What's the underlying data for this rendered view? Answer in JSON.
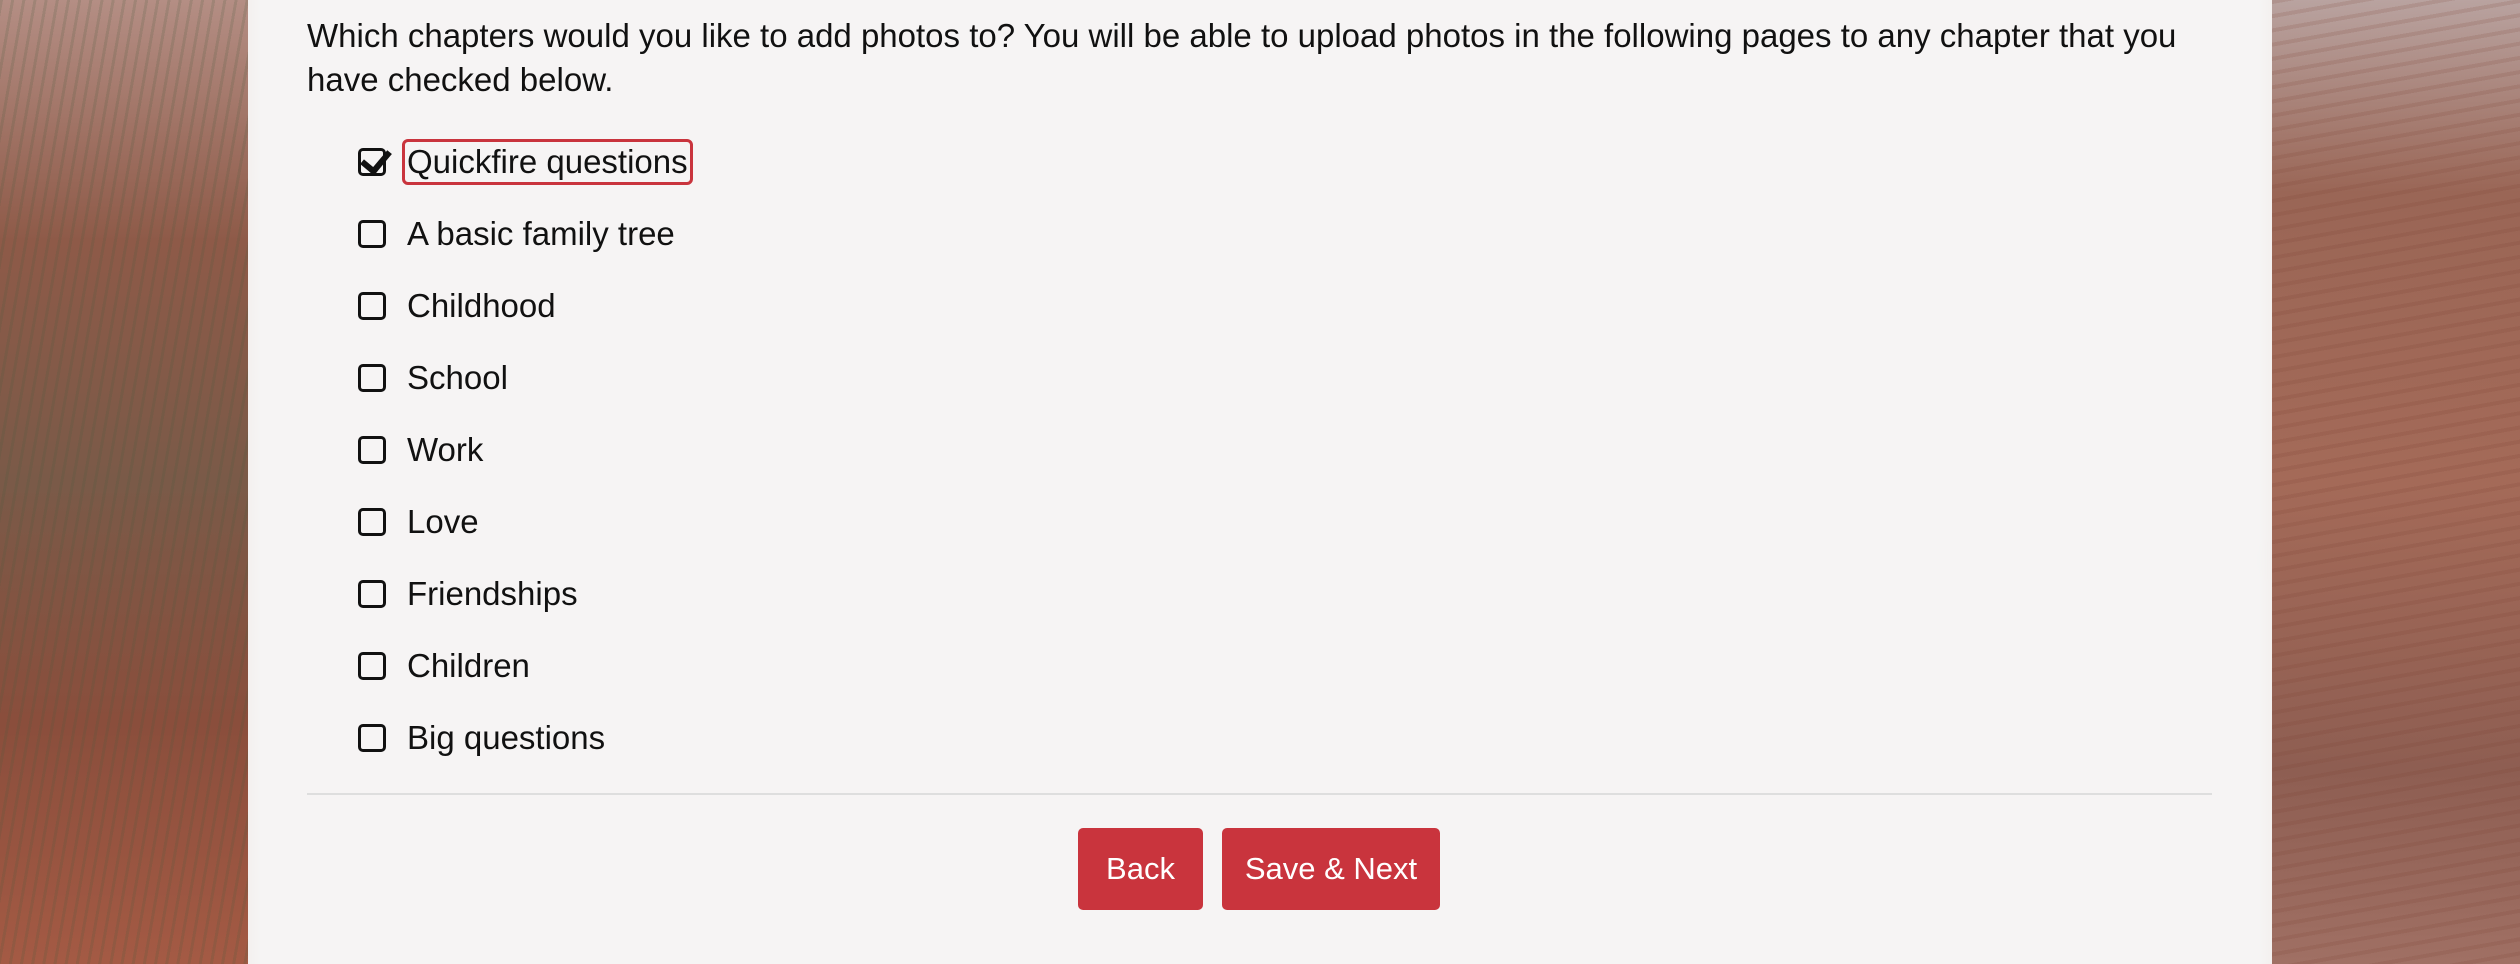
{
  "form": {
    "question": "Which chapters would you like to add photos to? You will be able to upload photos in the following pages to any chapter that you have checked below.",
    "chapters": [
      {
        "label": "Quickfire questions",
        "checked": true,
        "focused": true
      },
      {
        "label": "A basic family tree",
        "checked": false
      },
      {
        "label": "Childhood",
        "checked": false
      },
      {
        "label": "School",
        "checked": false
      },
      {
        "label": "Work",
        "checked": false
      },
      {
        "label": "Love",
        "checked": false
      },
      {
        "label": "Friendships",
        "checked": false
      },
      {
        "label": "Children",
        "checked": false
      },
      {
        "label": "Big questions",
        "checked": false
      }
    ]
  },
  "buttons": {
    "back_label": "Back",
    "next_label": "Save & Next"
  },
  "colors": {
    "accent": "#c9343d",
    "panel": "#f8f7f7"
  }
}
